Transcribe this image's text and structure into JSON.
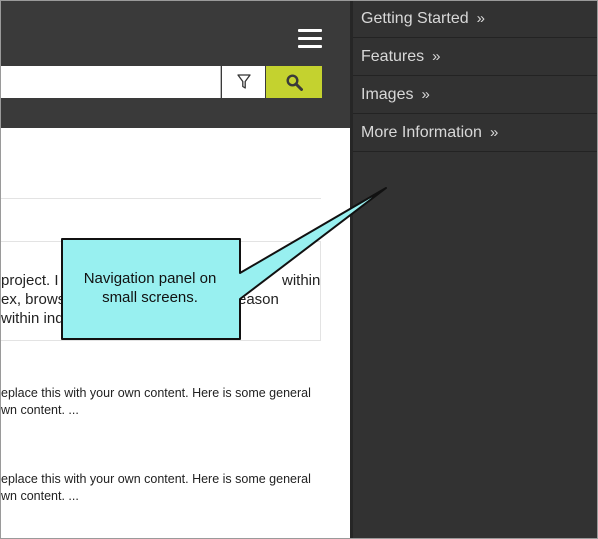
{
  "header": {
    "search_placeholder": "",
    "filter_icon": "filter-icon",
    "search_icon": "search-icon",
    "menu_icon": "hamburger-menu-icon",
    "accent_color": "#c4d22f"
  },
  "content": {
    "result_lines": [
      "project. I",
      "ex, brows",
      "within ind"
    ],
    "result_lines_right": [
      "within",
      "eason"
    ],
    "snippet1": [
      "eplace this with your own content. Here is some general",
      "wn content. ..."
    ],
    "snippet2": [
      "eplace this with your own content. Here is some general",
      "wn content. ..."
    ]
  },
  "callout": {
    "text_line1": "Navigation panel on",
    "text_line2": "small screens.",
    "fill_color": "#98f0f0"
  },
  "nav": {
    "items": [
      {
        "label": "Getting Started",
        "chevron": "»"
      },
      {
        "label": "Features",
        "chevron": "»"
      },
      {
        "label": "Images",
        "chevron": "»"
      },
      {
        "label": "More Information",
        "chevron": "»"
      }
    ]
  }
}
